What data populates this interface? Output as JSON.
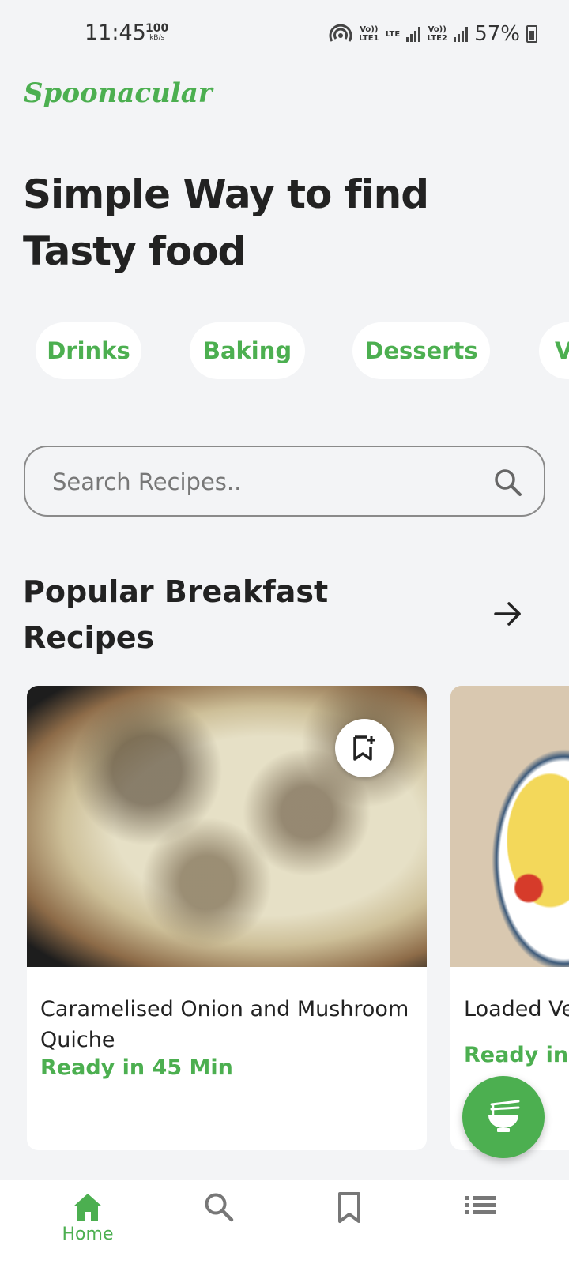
{
  "status_bar": {
    "time": "11:45",
    "speed_value": "100",
    "speed_unit": "kB/s",
    "sim1_label": "Vo)) LTE1",
    "net_label": "LTE",
    "sim2_label": "Vo)) LTE2",
    "battery": "57%"
  },
  "brand": {
    "name": "Spoonacular",
    "color": "#4caf50"
  },
  "hero": {
    "line1": "Simple Way to find",
    "line2": "Tasty food"
  },
  "categories": [
    "Drinks",
    "Baking",
    "Desserts",
    "V"
  ],
  "search": {
    "placeholder": "Search Recipes.."
  },
  "section": {
    "title_line1": "Popular Breakfast",
    "title_line2": "Recipes"
  },
  "recipes": [
    {
      "title": "Caramelised Onion and Mushroom Quiche",
      "ready": "Ready in 45 Min"
    },
    {
      "title": "Loaded Ve",
      "ready": "Ready in 4"
    }
  ],
  "nav": {
    "items": [
      {
        "label": "Home",
        "icon": "home-icon",
        "active": true
      },
      {
        "label": "",
        "icon": "search-icon",
        "active": false
      },
      {
        "label": "",
        "icon": "bookmark-icon",
        "active": false
      },
      {
        "label": "",
        "icon": "list-icon",
        "active": false
      }
    ]
  },
  "colors": {
    "accent": "#4caf50",
    "background": "#f3f4f6",
    "inactive_icon": "#777777"
  }
}
